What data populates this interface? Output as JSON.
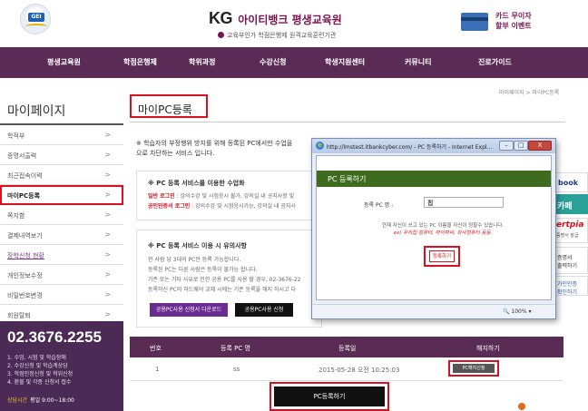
{
  "header": {
    "logo_text": "GEI",
    "brand_kg": "KG",
    "brand_title": "아이티뱅크 평생교육원",
    "brand_sub": "교육부인가 학점은행제 원격교육훈련기관",
    "event_line1": "카드 무이자",
    "event_line2": "할부 이벤트"
  },
  "nav": {
    "items": [
      "평생교육원",
      "학점은행제",
      "학위과정",
      "수강신청",
      "학생지원센터",
      "커뮤니티",
      "진로가이드"
    ]
  },
  "sidebar": {
    "title": "마이페이지",
    "items": [
      {
        "label": "학적부",
        "arrow": ">"
      },
      {
        "label": "증명서출력",
        "arrow": ">"
      },
      {
        "label": "최근접속이력",
        "arrow": ">"
      },
      {
        "label": "마이PC등록",
        "arrow": ">"
      },
      {
        "label": "쪽지함",
        "arrow": ">"
      },
      {
        "label": "결제내역보기",
        "arrow": ">"
      },
      {
        "label": "장학신청 현황",
        "arrow": ">"
      },
      {
        "label": "개인정보수정",
        "arrow": ">"
      },
      {
        "label": "비밀번호변경",
        "arrow": ">"
      },
      {
        "label": "회원탈퇴",
        "arrow": ">"
      }
    ],
    "phone": "02.3676.2255",
    "phone_lines": [
      "1. 수업, 시험 및 학습장애",
      "2. 수강신청 및 학습계상담",
      "3. 학점인정신청 및 학위신청",
      "4. 환불 및 각종 신청서 접수"
    ],
    "hours_label": "상담시간",
    "hours_value": "평일 9:00~18:00"
  },
  "main": {
    "breadcrumb": "마이페이지 > 마이PC등록",
    "page_title": "마이PC등록",
    "notice_line1": "※ 학습자의 부정행위 방지를 위해 등록된 PC에서만 수업을",
    "notice_line2": "으로 차단하는 서비스 입니다.",
    "box1_heading": "※ PC 등록 서비스를 이용한 수업화",
    "box1_line1_red": "일반 로그인",
    "box1_line1": " : 강의수강 및 시험응시 불가, 강의실 내 공지사항 및",
    "box1_line2_red": "공인인증서 로그인",
    "box1_line2": " : 강의수강 및 시험응시가능, 강의실 내 공지사",
    "box2_heading": "※ PC 등록 서비스 이용 시 유의사항",
    "box2_lines": [
      "한 사람 당 3대의 PC만 등록 가능합니다.",
      "등록된 PC는 다른 사람은 등록이 불가능 합니다.",
      "기존 또는 기타 사유로 인한 공용 PC를 사용 할 경우, 02-3676-22",
      "등록하신 PC의 하드웨어 교체 시에는 기존 등록을 해지 하시고 다"
    ],
    "btn_public_pc": "공용PC사용 신청서 다운로드",
    "btn_public_apply": "공용PC사용 신청",
    "table_headers": [
      "번호",
      "등록 PC 명",
      "등록일",
      "해지하기"
    ],
    "table_rows": [
      {
        "no": "1",
        "pc_name": "ss",
        "date": "2015-05-28 오전 10:25:03",
        "action": "PC해지신청"
      }
    ],
    "register_button": "PC등록하기"
  },
  "ads": {
    "ad1": "book",
    "ad2": "카페",
    "ad3_a": "ertpia",
    "ad3_b": "증명서 발급",
    "ad4_l1": "증명서",
    "ad4_l2": "출력하기",
    "ad5_l1": "가인인증",
    "ad5_l2": "확인하기"
  },
  "popup": {
    "titlebar": "http://lmstest.itbankcyber.com/ - PC 등록하기 - Internet Expl...",
    "header": "PC 등록하기",
    "field_label": "등록 PC 명 :",
    "field_value": "집",
    "clear": "×",
    "hint1": "현재 자신이 쓰고 있는 PC 이름을 자신이 정할수 있습니다.",
    "hint2": "ex) 우리집 컴퓨터, 마이파씨, 회사컴퓨터 등등.",
    "register": "등록하기",
    "zoom": "100%",
    "btn_min": "–",
    "btn_max": "□",
    "btn_close": "X"
  },
  "colors": {
    "nav_bg": "#5a2b55",
    "accent_red": "#d9101e",
    "popup_header": "#3e6b1e",
    "phone_box": "#4b2a55"
  }
}
